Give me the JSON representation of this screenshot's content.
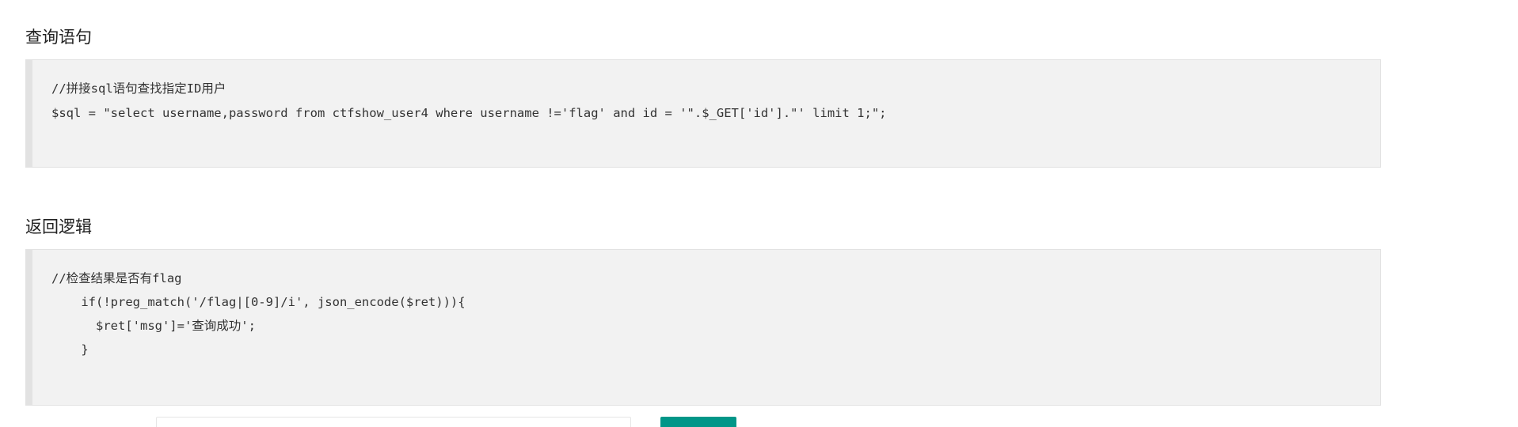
{
  "sections": [
    {
      "title": "查询语句",
      "code_lines": [
        "//拼接sql语句查找指定ID用户",
        "$sql = \"select username,password from ctfshow_user4 where username !='flag' and id = '\".$_GET['id'].\"' limit 1;\";"
      ]
    },
    {
      "title": "返回逻辑",
      "code_lines": [
        "//检查结果是否有flag",
        "    if(!preg_match('/flag|[0-9]/i', json_encode($ret))){",
        "      $ret['msg']='查询成功';",
        "    }"
      ]
    }
  ],
  "form": {
    "input_value": "",
    "button_label": ""
  }
}
